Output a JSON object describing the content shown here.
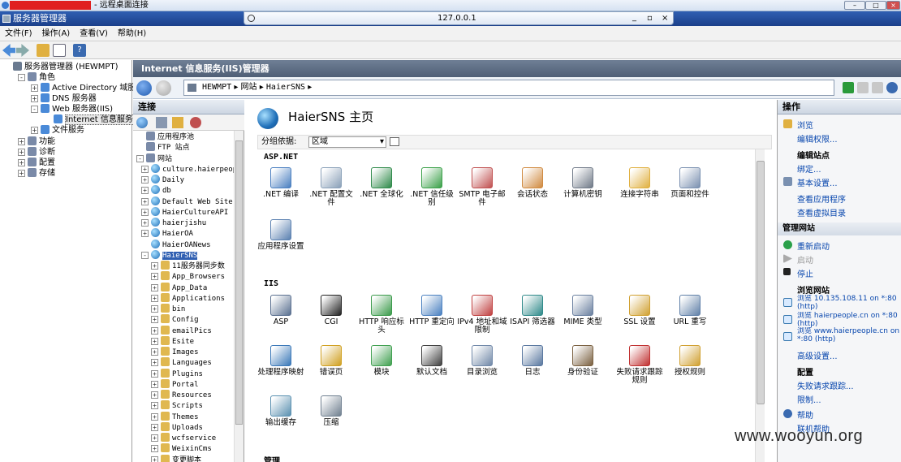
{
  "window": {
    "rdp_title": "- 远程桌面连接",
    "rdp_address": "127.0.0.1",
    "server_manager_title": "服务器管理器"
  },
  "menu": [
    "文件(F)",
    "操作(A)",
    "查看(V)",
    "帮助(H)"
  ],
  "left_tree": [
    {
      "label": "服务器管理器 (HEWMPT)",
      "level": 0,
      "exp": ""
    },
    {
      "label": "角色",
      "level": 1,
      "exp": "-"
    },
    {
      "label": "Active Directory 域服务",
      "level": 2,
      "exp": "+"
    },
    {
      "label": "DNS 服务器",
      "level": 2,
      "exp": "+"
    },
    {
      "label": "Web 服务器(IIS)",
      "level": 2,
      "exp": "-"
    },
    {
      "label": "Internet 信息服务 (",
      "level": 3,
      "exp": "",
      "selected": true
    },
    {
      "label": "文件服务",
      "level": 2,
      "exp": "+"
    },
    {
      "label": "功能",
      "level": 1,
      "exp": "+"
    },
    {
      "label": "诊断",
      "level": 1,
      "exp": "+"
    },
    {
      "label": "配置",
      "level": 1,
      "exp": "+"
    },
    {
      "label": "存储",
      "level": 1,
      "exp": "+"
    }
  ],
  "iis_header": "Internet 信息服务(IIS)管理器",
  "breadcrumb": [
    "HEWMPT",
    "网站",
    "HaierSNS"
  ],
  "connections": {
    "title": "连接",
    "items": [
      {
        "label": "应用程序池",
        "level": 0,
        "exp": ""
      },
      {
        "label": "FTP 站点",
        "level": 0,
        "exp": ""
      },
      {
        "label": "网站",
        "level": 0,
        "exp": "-"
      },
      {
        "label": "culture.haierpeop",
        "level": 1,
        "exp": "+"
      },
      {
        "label": "Daily",
        "level": 1,
        "exp": "+"
      },
      {
        "label": "db",
        "level": 1,
        "exp": "+"
      },
      {
        "label": "Default Web Site",
        "level": 1,
        "exp": "+"
      },
      {
        "label": "HaierCultureAPI",
        "level": 1,
        "exp": "+"
      },
      {
        "label": "haierjishu",
        "level": 1,
        "exp": "+"
      },
      {
        "label": "HaierOA",
        "level": 1,
        "exp": "+"
      },
      {
        "label": "HaierOANews",
        "level": 1,
        "exp": ""
      },
      {
        "label": "HaierSNS",
        "level": 1,
        "exp": "-",
        "selected": true
      },
      {
        "label": "11服务器同步数",
        "level": 2,
        "exp": "+"
      },
      {
        "label": "App_Browsers",
        "level": 2,
        "exp": "+"
      },
      {
        "label": "App_Data",
        "level": 2,
        "exp": "+"
      },
      {
        "label": "Applications",
        "level": 2,
        "exp": "+"
      },
      {
        "label": "bin",
        "level": 2,
        "exp": "+"
      },
      {
        "label": "Config",
        "level": 2,
        "exp": "+"
      },
      {
        "label": "emailPics",
        "level": 2,
        "exp": "+"
      },
      {
        "label": "Esite",
        "level": 2,
        "exp": "+"
      },
      {
        "label": "Images",
        "level": 2,
        "exp": "+"
      },
      {
        "label": "Languages",
        "level": 2,
        "exp": "+"
      },
      {
        "label": "Plugins",
        "level": 2,
        "exp": "+"
      },
      {
        "label": "Portal",
        "level": 2,
        "exp": "+"
      },
      {
        "label": "Resources",
        "level": 2,
        "exp": "+"
      },
      {
        "label": "Scripts",
        "level": 2,
        "exp": "+"
      },
      {
        "label": "Themes",
        "level": 2,
        "exp": "+"
      },
      {
        "label": "Uploads",
        "level": 2,
        "exp": "+"
      },
      {
        "label": "wcfservice",
        "level": 2,
        "exp": "+"
      },
      {
        "label": "WeixinCms",
        "level": 2,
        "exp": "+"
      },
      {
        "label": "变更脚本",
        "level": 2,
        "exp": "+"
      }
    ]
  },
  "center": {
    "title": "HaierSNS 主页",
    "groupby_label": "分组依据:",
    "groupby_value": "区域",
    "sections": [
      {
        "name": "ASP.NET",
        "features": [
          {
            "label": ".NET 编译",
            "icon": "net-compile-icon",
            "color": "#4a7fc0"
          },
          {
            "label": ".NET 配置文件",
            "icon": "net-profile-icon",
            "color": "#8aa0b8"
          },
          {
            "label": ".NET 全球化",
            "icon": "net-globalization-icon",
            "color": "#2f8a4a"
          },
          {
            "label": ".NET 信任级别",
            "icon": "net-trust-icon",
            "color": "#3aa048"
          },
          {
            "label": "SMTP 电子邮件",
            "icon": "smtp-email-icon",
            "color": "#c05050"
          },
          {
            "label": "会话状态",
            "icon": "session-state-icon",
            "color": "#d08a40"
          },
          {
            "label": "计算机密钥",
            "icon": "machine-key-icon",
            "color": "#707a88"
          },
          {
            "label": "连接字符串",
            "icon": "connection-strings-icon",
            "color": "#e0b040"
          },
          {
            "label": "页面和控件",
            "icon": "pages-controls-icon",
            "color": "#7a90b0"
          },
          {
            "label": "应用程序设置",
            "icon": "app-settings-icon",
            "color": "#5a80b0"
          }
        ]
      },
      {
        "name": "IIS",
        "features": [
          {
            "label": "ASP",
            "icon": "asp-icon",
            "color": "#5a7090"
          },
          {
            "label": "CGI",
            "icon": "cgi-icon",
            "color": "#222222"
          },
          {
            "label": "HTTP 响应标头",
            "icon": "http-headers-icon",
            "color": "#3a9a4a"
          },
          {
            "label": "HTTP 重定向",
            "icon": "http-redirect-icon",
            "color": "#4a80c0"
          },
          {
            "label": "IPv4 地址和域限制",
            "icon": "ipv4-restrict-icon",
            "color": "#c04040"
          },
          {
            "label": "ISAPI 筛选器",
            "icon": "isapi-filter-icon",
            "color": "#2f8a8a"
          },
          {
            "label": "MIME 类型",
            "icon": "mime-types-icon",
            "color": "#6a80a0"
          },
          {
            "label": "SSL 设置",
            "icon": "ssl-lock-icon",
            "color": "#d0a030"
          },
          {
            "label": "URL 重写",
            "icon": "url-rewrite-icon",
            "color": "#6080a8"
          },
          {
            "label": "处理程序映射",
            "icon": "handler-mappings-icon",
            "color": "#3a78b8"
          },
          {
            "label": "错误页",
            "icon": "error-pages-icon",
            "color": "#d0a020"
          },
          {
            "label": "模块",
            "icon": "modules-icon",
            "color": "#40a050"
          },
          {
            "label": "默认文档",
            "icon": "default-document-icon",
            "color": "#404040"
          },
          {
            "label": "目录浏览",
            "icon": "directory-browsing-icon",
            "color": "#7088a8"
          },
          {
            "label": "日志",
            "icon": "logging-icon",
            "color": "#5a78a0"
          },
          {
            "label": "身份验证",
            "icon": "authentication-icon",
            "color": "#7a6040"
          },
          {
            "label": "失败请求跟踪规则",
            "icon": "failed-request-icon",
            "color": "#c03030"
          },
          {
            "label": "授权规则",
            "icon": "authorization-icon",
            "color": "#d0a030"
          },
          {
            "label": "输出缓存",
            "icon": "output-cache-icon",
            "color": "#5a90b0"
          },
          {
            "label": "压缩",
            "icon": "compression-icon",
            "color": "#708090"
          }
        ]
      },
      {
        "name": "管理",
        "features": []
      }
    ]
  },
  "actions": {
    "title": "操作",
    "browse": "浏览",
    "edit_permissions": "编辑权限...",
    "edit_site_head": "编辑站点",
    "bindings": "绑定...",
    "basic_settings": "基本设置...",
    "view_apps": "查看应用程序",
    "view_vdirs": "查看虚拟目录",
    "manage_site_head": "管理网站",
    "restart": "重新启动",
    "start": "启动",
    "stop": "停止",
    "browse_site_head": "浏览网站",
    "browse_links": [
      "浏览 10.135.108.11 on *:80 (http)",
      "浏览 haierpeople.cn on *:80 (http)",
      "浏览 www.haierpeople.cn on *:80 (http)"
    ],
    "advanced_settings": "高级设置...",
    "config_head": "配置",
    "failed_request_tracing": "失败请求跟踪...",
    "limits": "限制...",
    "help": "帮助",
    "online_help": "联机帮助"
  },
  "watermark": "www.wooyun.org"
}
